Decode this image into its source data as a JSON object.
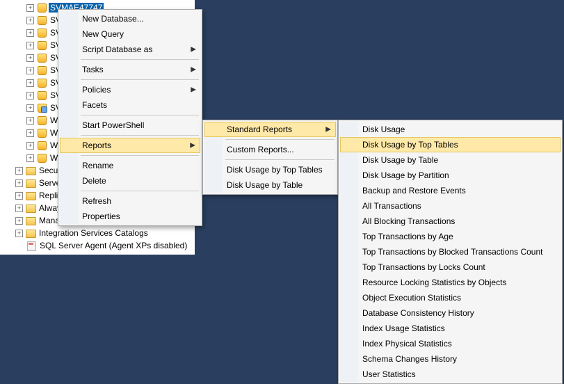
{
  "tree": {
    "selected_db": "SVMAE47747",
    "partial_dbs": [
      "SV",
      "SV",
      "SV",
      "SV",
      "SV",
      "SV",
      "SV",
      "SV",
      "W",
      "W",
      "W",
      "W"
    ],
    "special_index": 7,
    "nodes": [
      {
        "label": "Security",
        "level": 1
      },
      {
        "label": "Server Objects",
        "level": 1
      },
      {
        "label": "Replication",
        "level": 1
      },
      {
        "label": "AlwaysOn High Availability",
        "level": 1
      },
      {
        "label": "Management",
        "level": 1
      },
      {
        "label": "Integration Services Catalogs",
        "level": 1
      }
    ],
    "agent": "SQL Server Agent (Agent XPs disabled)"
  },
  "menu1": {
    "items": [
      {
        "label": "New Database..."
      },
      {
        "label": "New Query"
      },
      {
        "label": "Script Database as",
        "sub": true
      },
      {
        "sep": true
      },
      {
        "label": "Tasks",
        "sub": true
      },
      {
        "sep": true
      },
      {
        "label": "Policies",
        "sub": true
      },
      {
        "label": "Facets"
      },
      {
        "sep": true
      },
      {
        "label": "Start PowerShell"
      },
      {
        "sep": true
      },
      {
        "label": "Reports",
        "sub": true,
        "hover": true
      },
      {
        "sep": true
      },
      {
        "label": "Rename"
      },
      {
        "label": "Delete"
      },
      {
        "sep": true
      },
      {
        "label": "Refresh"
      },
      {
        "label": "Properties"
      }
    ]
  },
  "menu2": {
    "items": [
      {
        "label": "Standard Reports",
        "sub": true,
        "hover": true
      },
      {
        "sep": true
      },
      {
        "label": "Custom Reports..."
      },
      {
        "sep": true
      },
      {
        "label": "Disk Usage by Top Tables"
      },
      {
        "label": "Disk Usage by Table"
      }
    ]
  },
  "menu3": {
    "items": [
      {
        "label": "Disk Usage"
      },
      {
        "label": "Disk Usage by Top Tables",
        "hover": true
      },
      {
        "label": "Disk Usage by Table"
      },
      {
        "label": "Disk Usage by Partition"
      },
      {
        "label": "Backup and Restore Events"
      },
      {
        "label": "All Transactions"
      },
      {
        "label": "All Blocking Transactions"
      },
      {
        "label": "Top Transactions by Age"
      },
      {
        "label": "Top Transactions by Blocked Transactions Count"
      },
      {
        "label": "Top Transactions by Locks Count"
      },
      {
        "label": "Resource Locking Statistics by Objects"
      },
      {
        "label": "Object Execution Statistics"
      },
      {
        "label": "Database Consistency History"
      },
      {
        "label": "Index Usage Statistics"
      },
      {
        "label": "Index Physical Statistics"
      },
      {
        "label": "Schema Changes History"
      },
      {
        "label": "User Statistics"
      }
    ]
  }
}
